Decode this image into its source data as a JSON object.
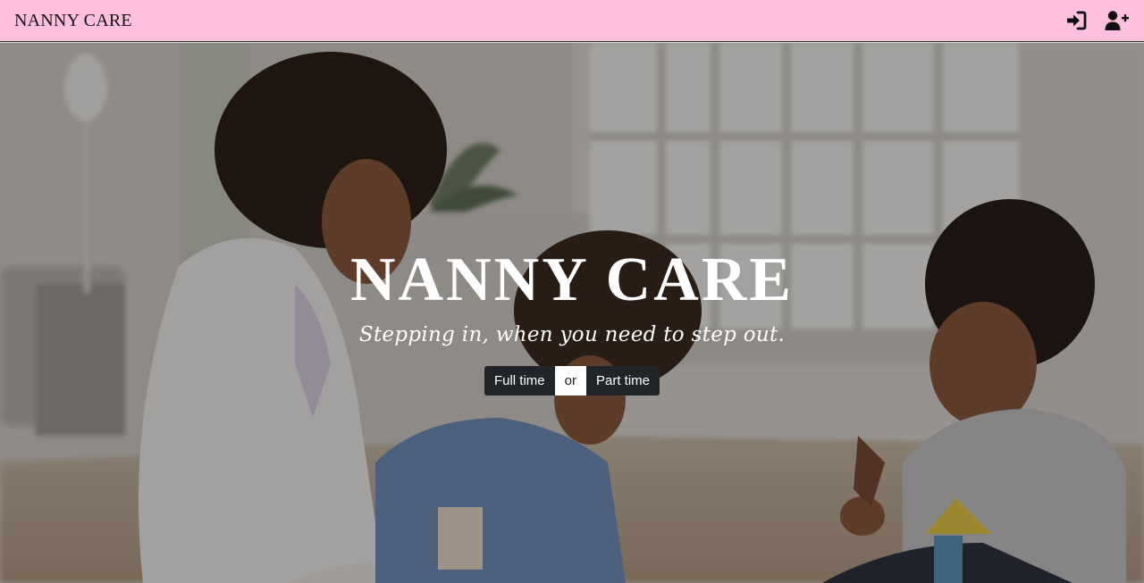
{
  "navbar": {
    "brand": "NANNY CARE",
    "login_icon": "sign-in-icon",
    "register_icon": "user-plus-icon"
  },
  "hero": {
    "title": "NANNY CARE",
    "subtitle": "Stepping in, when you need to step out.",
    "options": {
      "full_time": "Full time",
      "separator": "or",
      "part_time": "Part time"
    }
  },
  "colors": {
    "navbar_bg": "#ffc0e0",
    "button_dark": "#212529",
    "button_light": "#ffffff",
    "hero_text": "#ffffff"
  }
}
